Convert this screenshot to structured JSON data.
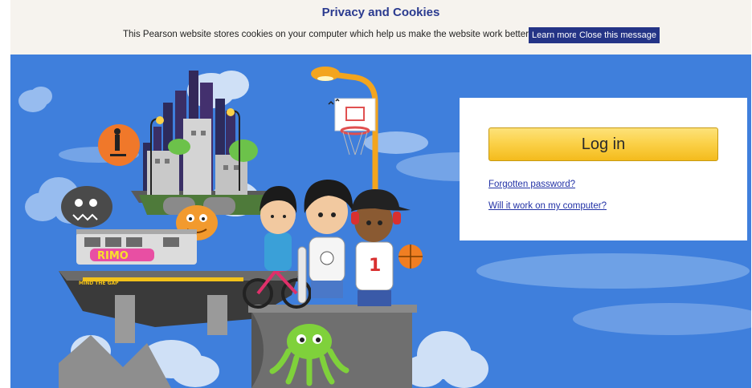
{
  "cookie_banner": {
    "title": "Privacy and Cookies",
    "message": "This Pearson website stores cookies on your computer which help us make the website work better for you.",
    "learn_more_label": "Learn more",
    "close_label": "Close this message"
  },
  "hero": {
    "graffiti_text": "RIMO",
    "sign_text": "MIND THE GAP",
    "jersey_number": "1"
  },
  "login": {
    "login_label": "Log in",
    "forgot_password_label": "Forgotten password?",
    "compatibility_label": "Will it work on my computer?"
  },
  "colors": {
    "sky": "#3f7fdc",
    "login_button": "#fbd24a",
    "link": "#2232a6",
    "cookie_button": "#243486"
  }
}
